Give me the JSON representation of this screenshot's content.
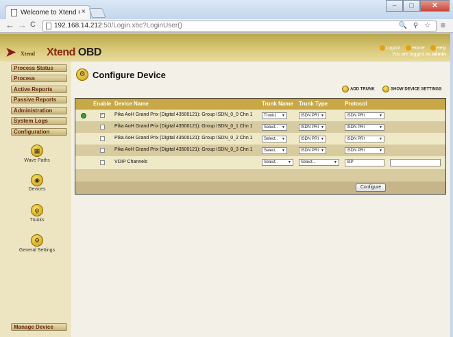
{
  "browser": {
    "tab_title": "Welcome to Xtend C",
    "url_host": "192.168.14.212",
    "url_rest": ":50/Login.xbc?LoginUser()",
    "nav_back": "←",
    "nav_forward": "→",
    "nav_reload": "C",
    "url_icons": "🔍 ⚲ ☆",
    "menu_icon": "≡",
    "win_min": "–",
    "win_max": "□",
    "win_close": "✕"
  },
  "header": {
    "logo_small": "Xtend",
    "logo_main": "Xtend",
    "logo_suffix": " OBD",
    "links": [
      "Logout",
      "Home",
      "Help"
    ],
    "user_prefix": "You are logged as ",
    "user_name": "admin"
  },
  "sidebar": {
    "buttons": [
      "Process Status",
      "Process",
      "Active Reports",
      "Passive Reports",
      "Administration",
      "System Logs",
      "Configuration"
    ],
    "items": [
      {
        "label": "Wave Paths",
        "icon": "wave-paths-icon",
        "glyph": "▦"
      },
      {
        "label": "Devices",
        "icon": "devices-icon",
        "glyph": "◉"
      },
      {
        "label": "Trunks",
        "icon": "trunks-icon",
        "glyph": "ψ"
      },
      {
        "label": "General Settings",
        "icon": "general-settings-icon",
        "glyph": "⚙"
      }
    ],
    "manage_device": "Manage Device"
  },
  "main": {
    "title": "Configure Device",
    "add_trunk": "Add Trunk",
    "show_device_settings": "Show Device Settings",
    "columns": [
      "Enable",
      "Device Name",
      "Trunk Name",
      "Trunk Type",
      "Protocol"
    ],
    "rows": [
      {
        "enabled": true,
        "device": "Pika AoH Grand Prix (Digital 43500121): Group ISDN_0_0 Chn 1",
        "trunk_name": "Trunk1",
        "trunk_type": "ISDN PRI",
        "protocol": "ISDN PRI"
      },
      {
        "enabled": false,
        "device": "Pika AoH Grand Prix (Digital 43500121): Group ISDN_0_1 Chn 1",
        "trunk_name": "Select..",
        "trunk_type": "ISDN PRI",
        "protocol": "ISDN PRI"
      },
      {
        "enabled": false,
        "device": "Pika AoH Grand Prix (Digital 43500121): Group ISDN_0_2 Chn 1",
        "trunk_name": "Select..",
        "trunk_type": "ISDN PRI",
        "protocol": "ISDN PRI"
      },
      {
        "enabled": false,
        "device": "Pika AoH Grand Prix (Digital 43500121): Group ISDN_0_3 Chn 1",
        "trunk_name": "Select..",
        "trunk_type": "ISDN PRI",
        "protocol": "ISDN PRI"
      }
    ],
    "voip": {
      "device": "VOIP Channels",
      "trunk_name": "Select..",
      "trunk_type": "Select...",
      "protocol": "SIP",
      "extra": ""
    },
    "configure_button": "Configure"
  },
  "colors": {
    "accent": "#c8a846",
    "brand": "#8b2a12",
    "sidebar": "#ede5c2"
  }
}
